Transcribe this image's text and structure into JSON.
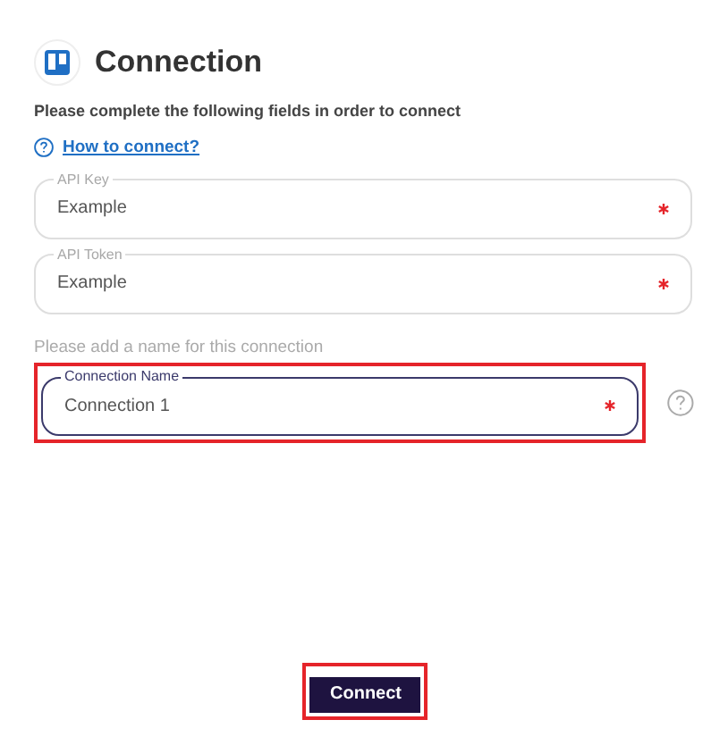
{
  "header": {
    "title": "Connection"
  },
  "instructions": "Please complete the following fields in order to connect",
  "help_link": "How to connect?",
  "fields": [
    {
      "label": "API Key",
      "value": "Example",
      "required": true,
      "focused": false,
      "highlighted": false
    },
    {
      "label": "API Token",
      "value": "Example",
      "required": true,
      "focused": false,
      "highlighted": false
    }
  ],
  "name_hint": "Please add a name for this connection",
  "name_field": {
    "label": "Connection Name",
    "value": "Connection 1",
    "required": true,
    "focused": true,
    "highlighted": true
  },
  "connect_button": {
    "label": "Connect",
    "highlighted": true
  }
}
